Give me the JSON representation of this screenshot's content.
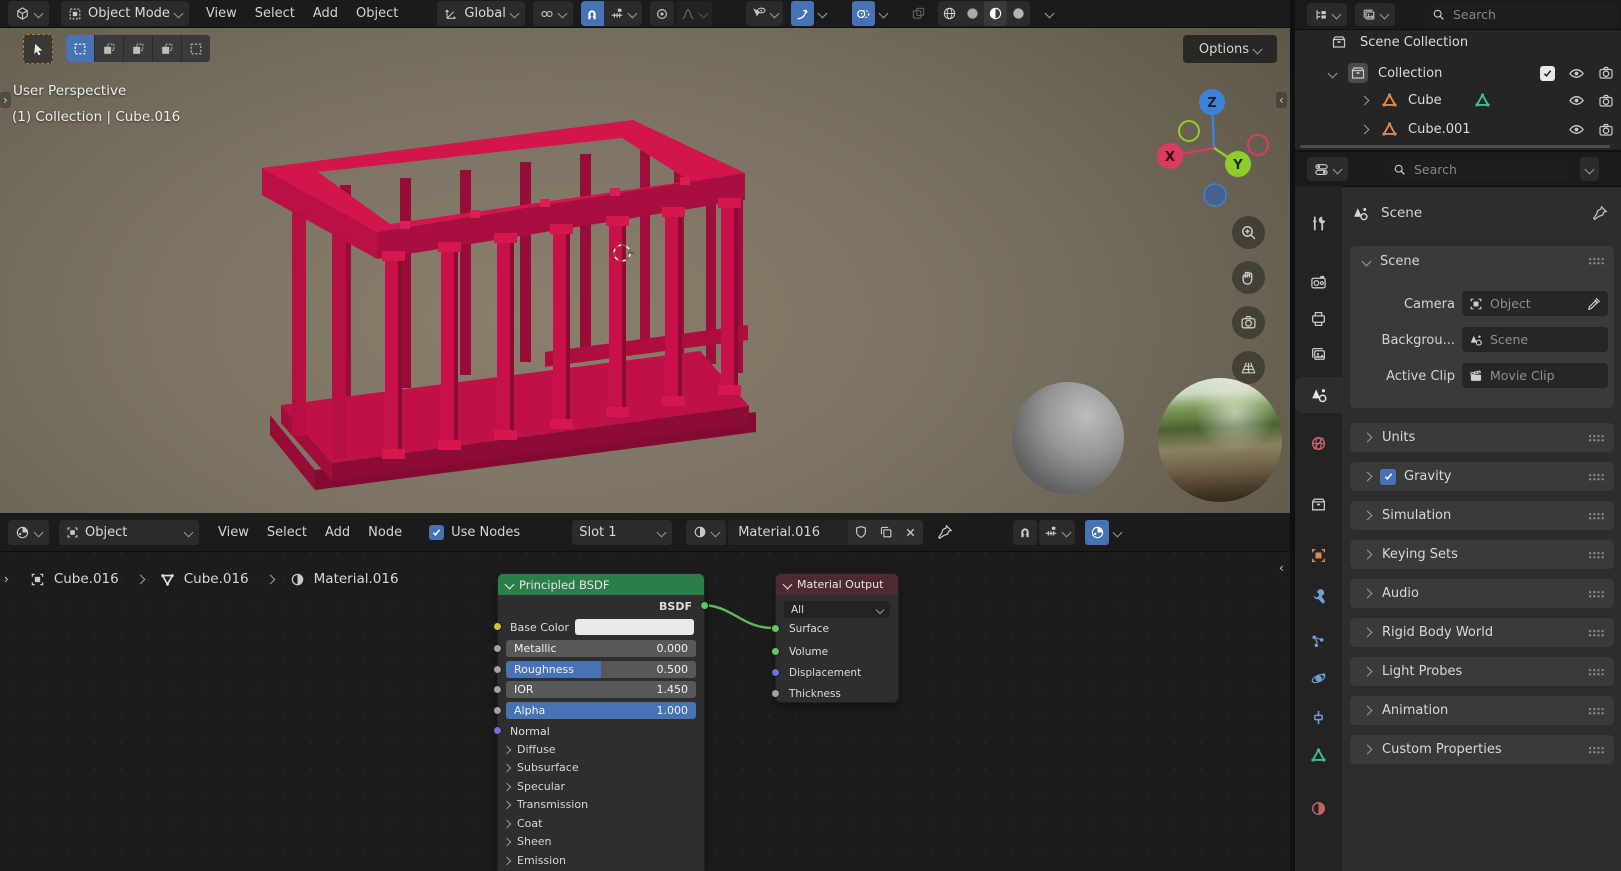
{
  "viewport_header": {
    "mode": "Object Mode",
    "menus": [
      "View",
      "Select",
      "Add",
      "Object"
    ],
    "orientation": "Global",
    "options": "Options"
  },
  "viewport": {
    "perspective": "User Perspective",
    "context": "(1) Collection | Cube.016",
    "axis": {
      "x": "X",
      "y": "Y",
      "z": "Z"
    }
  },
  "outliner": {
    "search_placeholder": "Search",
    "scene_collection": "Scene Collection",
    "collection": "Collection",
    "cube": "Cube",
    "cube001": "Cube.001"
  },
  "properties": {
    "search_placeholder": "Search",
    "breadcrumb": "Scene",
    "scene_panel_title": "Scene",
    "camera_label": "Camera",
    "camera_value": "Object",
    "background_label": "Backgrou...",
    "background_value": "Scene",
    "active_clip_label": "Active Clip",
    "active_clip_value": "Movie Clip",
    "panels": [
      "Units",
      "Gravity",
      "Simulation",
      "Keying Sets",
      "Audio",
      "Rigid Body World",
      "Light Probes",
      "Animation",
      "Custom Properties"
    ]
  },
  "shader_header": {
    "type": "Object",
    "menus": [
      "View",
      "Select",
      "Add",
      "Node"
    ],
    "use_nodes": "Use Nodes",
    "slot": "Slot 1",
    "material_name": "Material.016"
  },
  "shader": {
    "breadcrumb": [
      "Cube.016",
      "Cube.016",
      "Material.016"
    ],
    "bsdf_title": "Principled BSDF",
    "bsdf_output": "BSDF",
    "base_color_label": "Base Color",
    "sliders": [
      {
        "label": "Metallic",
        "value": "0.000"
      },
      {
        "label": "Roughness",
        "value": "0.500"
      },
      {
        "label": "IOR",
        "value": "1.450"
      },
      {
        "label": "Alpha",
        "value": "1.000"
      }
    ],
    "normal_label": "Normal",
    "sections": [
      "Diffuse",
      "Subsurface",
      "Specular",
      "Transmission",
      "Coat",
      "Sheen",
      "Emission"
    ],
    "output_title": "Material Output",
    "output_target": "All",
    "output_inputs": [
      "Surface",
      "Volume",
      "Displacement",
      "Thickness"
    ]
  },
  "colors": {
    "accent_blue": "#4772b3",
    "bsdf_header_green": "#2b7e48",
    "output_header_maroon": "#4d2a31",
    "structure_red": "#c91149",
    "socket_green": "#63c763",
    "socket_yellow": "#c7c729",
    "socket_purple": "#7070d8",
    "socket_gray": "#a1a1a1",
    "object_orange": "#d98a4c"
  }
}
